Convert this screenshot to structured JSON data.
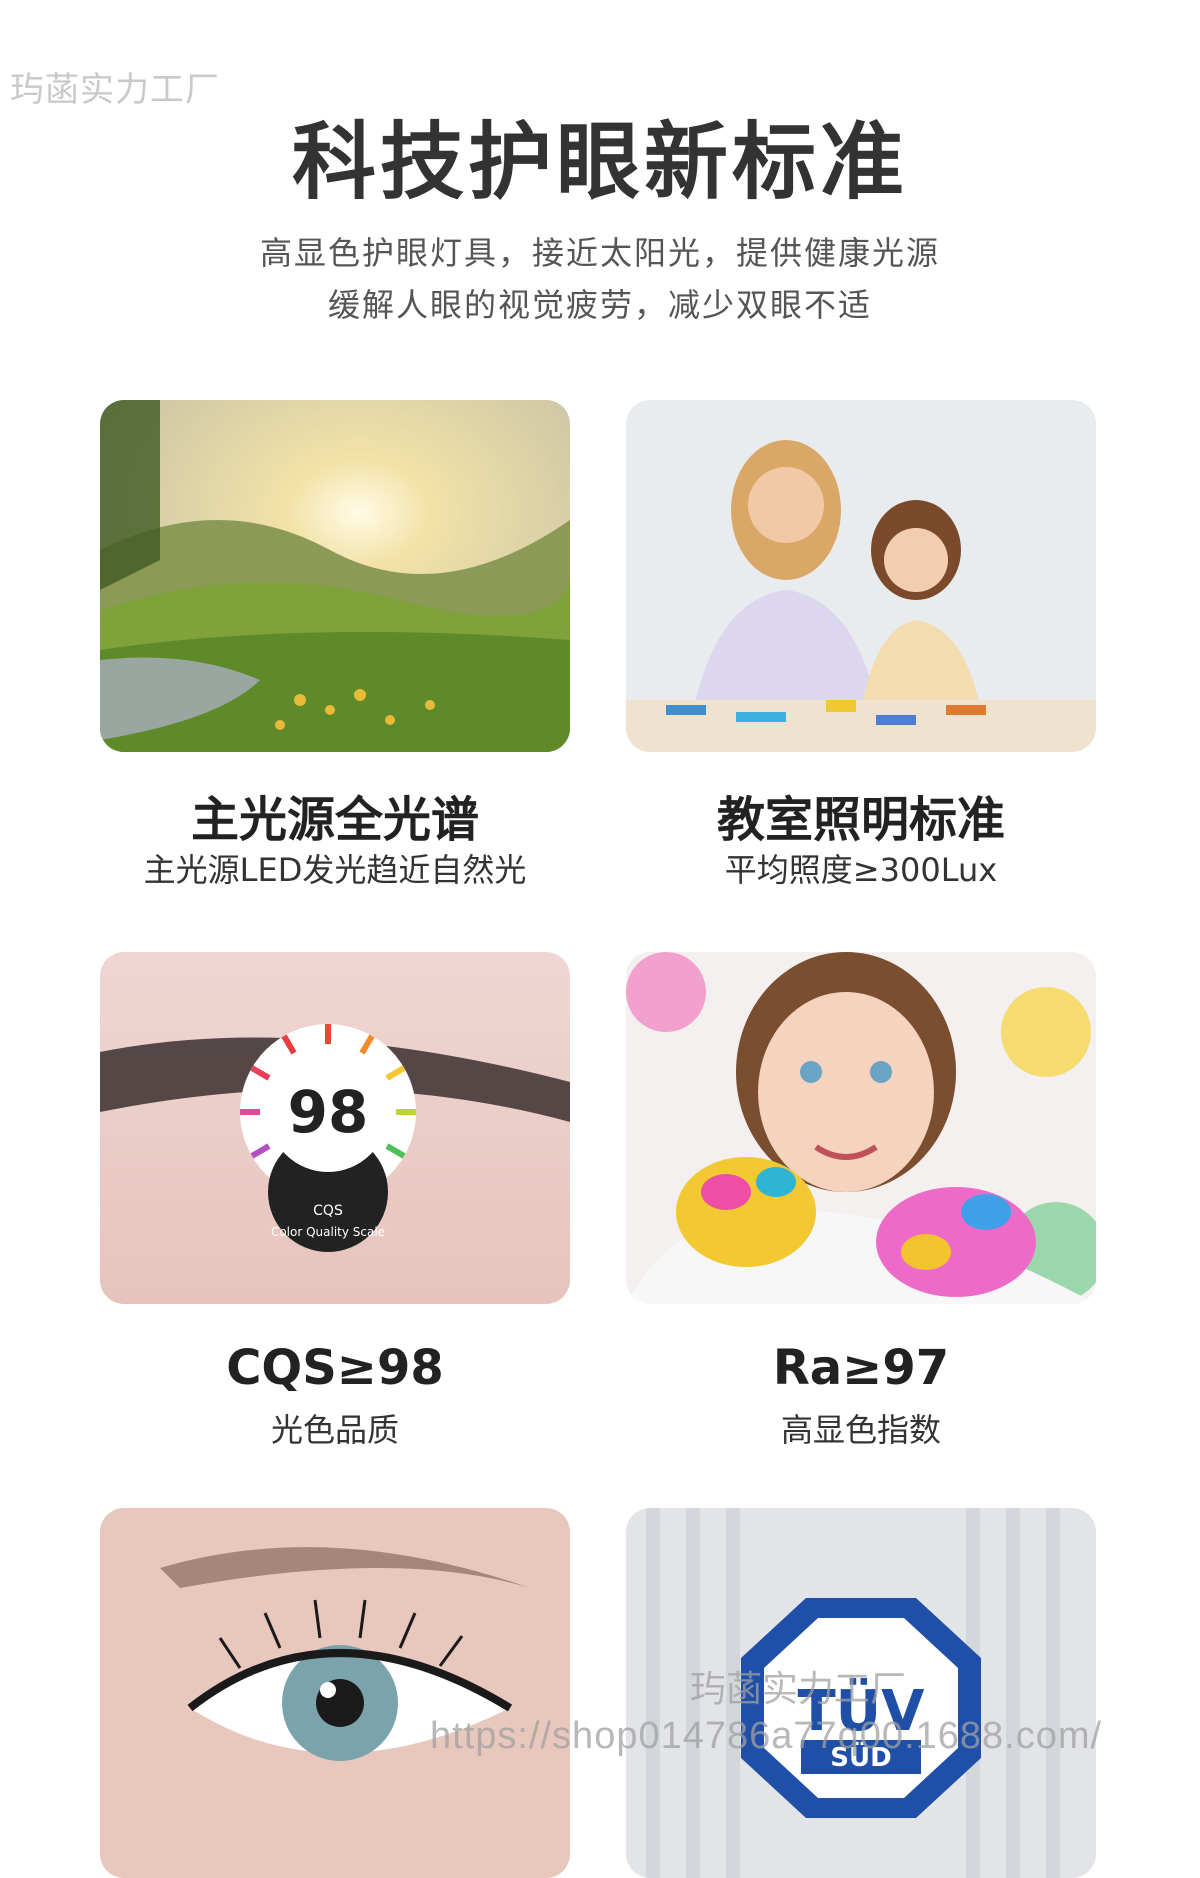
{
  "watermark_top": "玙菡实力工厂",
  "header": {
    "title": "科技护眼新标准",
    "subtitle_line1": "高显色护眼灯具，接近太阳光，提供健康光源",
    "subtitle_line2": "缓解人眼的视觉疲劳，减少双眼不适"
  },
  "features": [
    {
      "title": "主光源全光谱",
      "subtitle": "主光源LED发光趋近自然光"
    },
    {
      "title": "教室照明标准",
      "subtitle": "平均照度≥300Lux"
    },
    {
      "title": "CQS≥98",
      "subtitle": "光色品质"
    },
    {
      "title": "Ra≥97",
      "subtitle": "高显色指数"
    }
  ],
  "badges": {
    "cqs_value": "98",
    "cqs_label": "CQS",
    "cqs_caption": "Color Quality Scale",
    "tuv_top": "TÜV",
    "tuv_bottom": "SÜD"
  },
  "watermark_center": "玙菡实力工厂",
  "watermark_url": "https://shop014786a77q00.1688.com/"
}
